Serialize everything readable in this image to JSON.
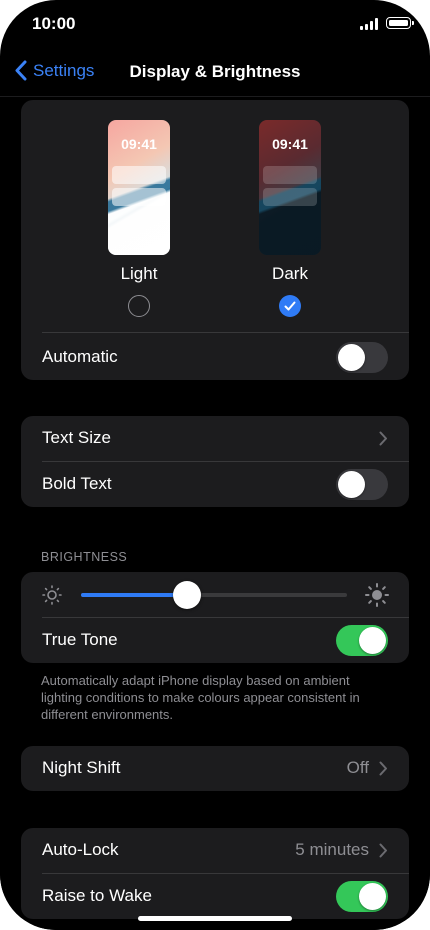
{
  "status": {
    "time": "10:00"
  },
  "nav": {
    "back_label": "Settings",
    "title": "Display & Brightness"
  },
  "appearance": {
    "light": {
      "label": "Light",
      "preview_time": "09:41",
      "selected": false
    },
    "dark": {
      "label": "Dark",
      "preview_time": "09:41",
      "selected": true
    },
    "automatic": {
      "label": "Automatic",
      "on": false
    }
  },
  "text_group": {
    "text_size": {
      "label": "Text Size"
    },
    "bold_text": {
      "label": "Bold Text",
      "on": false
    }
  },
  "brightness": {
    "header": "BRIGHTNESS",
    "level_fraction": 0.4,
    "true_tone": {
      "label": "True Tone",
      "on": true
    },
    "footnote": "Automatically adapt iPhone display based on ambient lighting conditions to make colours appear consistent in different environments."
  },
  "night_shift": {
    "label": "Night Shift",
    "value": "Off"
  },
  "lock_group": {
    "auto_lock": {
      "label": "Auto-Lock",
      "value": "5 minutes"
    },
    "raise_to_wake": {
      "label": "Raise to Wake",
      "on": true
    }
  },
  "colors": {
    "accent": "#3b82f6",
    "toggle_on": "#34c759",
    "group_bg": "#1c1c1e",
    "secondary_text": "#8e8e93"
  },
  "icons": [
    "chevron-left-icon",
    "chevron-right-icon",
    "sun-small-icon",
    "sun-large-icon",
    "checkmark-icon",
    "signal-icon",
    "battery-icon"
  ]
}
